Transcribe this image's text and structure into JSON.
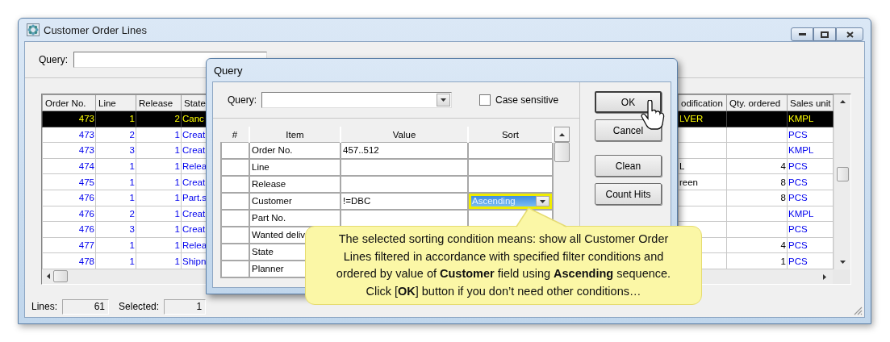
{
  "window": {
    "title": "Customer Order Lines",
    "query_label": "Query:"
  },
  "grid": {
    "columns": [
      "Order No.",
      "Line",
      "Release",
      "State",
      "odification",
      "Qty. ordered",
      "Sales unit"
    ],
    "rows": [
      {
        "order_no": "473",
        "line": "1",
        "release": "2",
        "state": "Canc",
        "modification": "LVER",
        "unit": "KMPL",
        "selected": true
      },
      {
        "order_no": "473",
        "line": "2",
        "release": "1",
        "state": "Creat",
        "unit": "PCS",
        "selected": false
      },
      {
        "order_no": "473",
        "line": "3",
        "release": "1",
        "state": "Creat",
        "unit": "KMPL",
        "selected": false
      },
      {
        "order_no": "474",
        "line": "1",
        "release": "1",
        "state": "Relea",
        "modification": "L",
        "qty": "4",
        "unit": "PCS",
        "selected": false
      },
      {
        "order_no": "475",
        "line": "1",
        "release": "1",
        "state": "Creat",
        "modification": "reen",
        "qty": "8",
        "unit": "PCS",
        "selected": false
      },
      {
        "order_no": "476",
        "line": "1",
        "release": "1",
        "state": "Part.s",
        "qty": "8",
        "unit": "PCS",
        "selected": false
      },
      {
        "order_no": "476",
        "line": "2",
        "release": "1",
        "state": "Creat",
        "unit": "KMPL",
        "selected": false
      },
      {
        "order_no": "476",
        "line": "3",
        "release": "1",
        "state": "Creat",
        "unit": "PCS",
        "selected": false
      },
      {
        "order_no": "477",
        "line": "1",
        "release": "1",
        "state": "Relea",
        "qty": "4",
        "unit": "PCS",
        "selected": false
      },
      {
        "order_no": "478",
        "line": "1",
        "release": "1",
        "state": "Shipn",
        "qty": "1",
        "unit": "PCS",
        "selected": false
      }
    ]
  },
  "status_bar": {
    "lines_label": "Lines:",
    "lines": "61",
    "selected_label": "Selected:",
    "selected": "1"
  },
  "dialog": {
    "title": "Query",
    "query_label": "Query:",
    "case_sensitive": {
      "label": "Case sensitive",
      "checked": false
    },
    "columns": [
      "#",
      "Item",
      "Value",
      "Sort"
    ],
    "rows": [
      {
        "item": "Order No.",
        "value": "457..512",
        "focused": false
      },
      {
        "item": "Line",
        "focused": false
      },
      {
        "item": "Release",
        "focused": false
      },
      {
        "item": "Customer",
        "value": "!=DBC",
        "sort": "Ascending",
        "focused": true
      },
      {
        "item": "Part No.",
        "focused": false
      },
      {
        "item": "Wanted deliv",
        "focused": false
      },
      {
        "item": "State",
        "focused": false
      },
      {
        "item": "Planner",
        "focused": false
      }
    ],
    "buttons": [
      {
        "label": "OK",
        "kind": "default"
      },
      {
        "label": "Cancel",
        "kind": "normal"
      },
      {
        "label": "Clean",
        "kind": "normal"
      },
      {
        "label": "Count Hits",
        "kind": "normal"
      }
    ]
  },
  "callout": {
    "lines": [
      "The selected sorting condition means: show all Customer Order",
      "Lines filtered in accordance with specified filter conditions and",
      "ordered by value of **Customer** field using **Ascending** sequence.",
      "Click [**OK**] button if you don’t need other conditions…"
    ]
  }
}
